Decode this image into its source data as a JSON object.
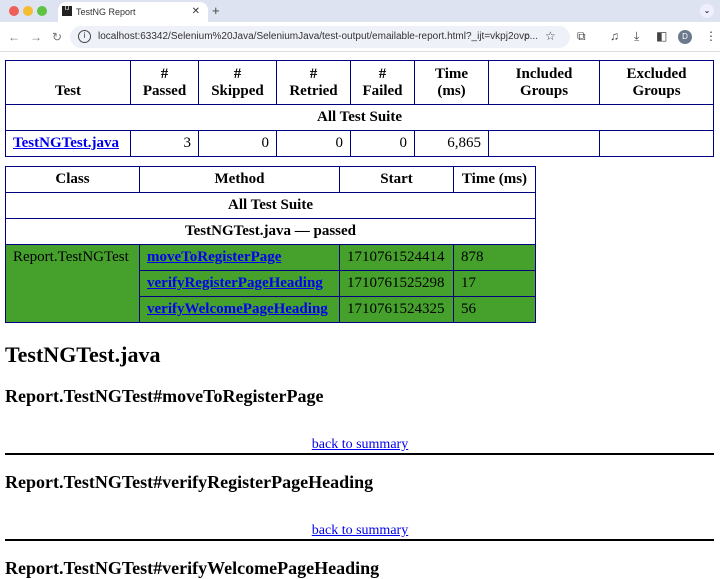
{
  "browser": {
    "tab_title": "TestNG Report",
    "url": "localhost:63342/Selenium%20Java/SeleniumJava/test-output/emailable-report.html?_ijt=vkpj2ovp...",
    "avatar": "D"
  },
  "summary": {
    "headers": [
      "Test",
      "#\nPassed",
      "#\nSkipped",
      "#\nRetried",
      "#\nFailed",
      "Time\n(ms)",
      "Included\nGroups",
      "Excluded\nGroups"
    ],
    "suite": "All Test Suite",
    "row": {
      "test": "TestNGTest.java",
      "passed": "3",
      "skipped": "0",
      "retried": "0",
      "failed": "0",
      "time": "6,865",
      "included": "",
      "excluded": ""
    }
  },
  "methods": {
    "headers": [
      "Class",
      "Method",
      "Start",
      "Time (ms)"
    ],
    "suite": "All Test Suite",
    "group": "TestNGTest.java — passed",
    "class": "Report.TestNGTest",
    "rows": [
      {
        "method": "moveToRegisterPage",
        "start": "1710761524414",
        "time": "878"
      },
      {
        "method": "verifyRegisterPageHeading",
        "start": "1710761525298",
        "time": "17"
      },
      {
        "method": "verifyWelcomePageHeading",
        "start": "1710761524325",
        "time": "56"
      }
    ],
    "pass_color": "#45a12c"
  },
  "details": {
    "title": "TestNGTest.java",
    "sections": [
      "Report.TestNGTest#moveToRegisterPage",
      "Report.TestNGTest#verifyRegisterPageHeading",
      "Report.TestNGTest#verifyWelcomePageHeading"
    ],
    "back_link": "back to summary"
  }
}
